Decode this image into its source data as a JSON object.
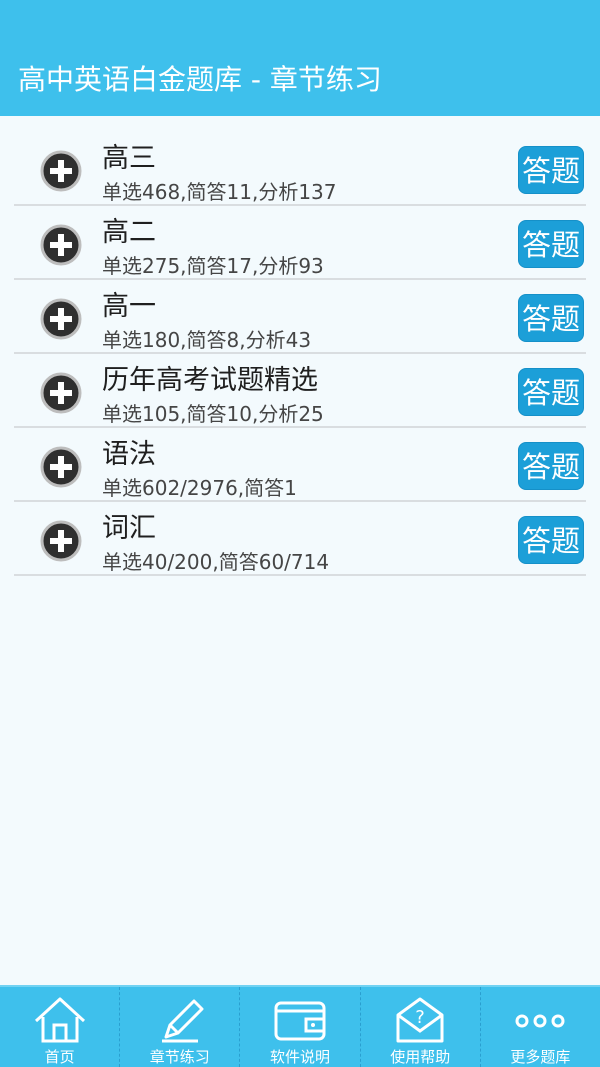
{
  "header": {
    "title": "高中英语白金题库 - 章节练习"
  },
  "chapters": [
    {
      "name": "高三",
      "stats": "单选468,简答11,分析137",
      "action": "答题"
    },
    {
      "name": "高二",
      "stats": "单选275,简答17,分析93",
      "action": "答题"
    },
    {
      "name": "高一",
      "stats": "单选180,简答8,分析43",
      "action": "答题"
    },
    {
      "name": "历年高考试题精选",
      "stats": "单选105,简答10,分析25",
      "action": "答题"
    },
    {
      "name": "语法",
      "stats": "单选602/2976,简答1",
      "action": "答题"
    },
    {
      "name": "词汇",
      "stats": "单选40/200,简答60/714",
      "action": "答题"
    }
  ],
  "tabs": [
    {
      "label": "首页",
      "icon": "home-icon"
    },
    {
      "label": "章节练习",
      "icon": "pencil-icon"
    },
    {
      "label": "软件说明",
      "icon": "wallet-icon"
    },
    {
      "label": "使用帮助",
      "icon": "help-envelope-icon"
    },
    {
      "label": "更多题库",
      "icon": "more-dots-icon"
    }
  ],
  "colors": {
    "header": "#3ec0ec",
    "answer_button": "#1c9fd8",
    "background": "#f3fafd"
  }
}
